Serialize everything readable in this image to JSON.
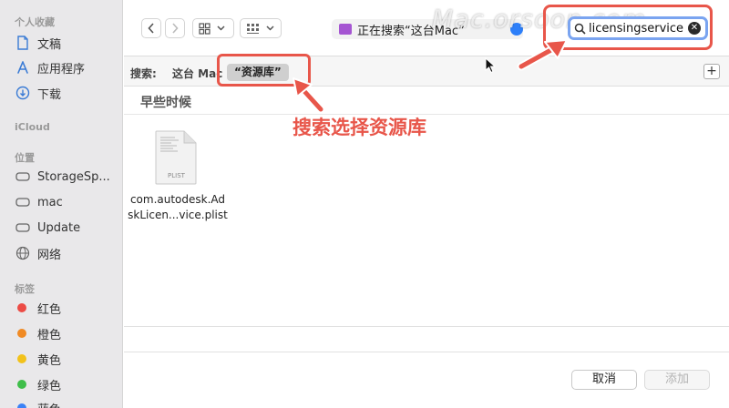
{
  "sidebar": {
    "favorites_title": "个人收藏",
    "favorites": [
      {
        "label": "文稿",
        "icon": "document-icon"
      },
      {
        "label": "应用程序",
        "icon": "applications-icon"
      },
      {
        "label": "下载",
        "icon": "download-icon"
      }
    ],
    "icloud_title": "iCloud",
    "locations_title": "位置",
    "locations": [
      {
        "label": "StorageSp...",
        "icon": "drive-icon"
      },
      {
        "label": "mac",
        "icon": "drive-icon"
      },
      {
        "label": "Update",
        "icon": "drive-icon"
      },
      {
        "label": "网络",
        "icon": "network-icon"
      }
    ],
    "tags_title": "标签",
    "tags": [
      {
        "label": "红色",
        "color": "#ec4b45"
      },
      {
        "label": "橙色",
        "color": "#f08a24"
      },
      {
        "label": "黄色",
        "color": "#f2c21b"
      },
      {
        "label": "绿色",
        "color": "#3fbe4a"
      },
      {
        "label": "蓝色",
        "color": "#3b82f6"
      }
    ]
  },
  "toolbar": {
    "path_label": "正在搜索“这台Mac”",
    "watermark": "Mac.orsoon.com",
    "search_value": "licensingservice"
  },
  "scope": {
    "label": "搜索:",
    "this_mac": "这台 Mac",
    "library": "“资源库”"
  },
  "content": {
    "group_header": "早些时候",
    "file": {
      "type_label": "PLIST",
      "name_line1": "com.autodesk.Ad",
      "name_line2": "skLicen...vice.plist"
    },
    "annotation": "搜索选择资源库"
  },
  "footer": {
    "cancel_label": "取消",
    "add_label": "添加"
  },
  "colors": {
    "accent_red": "#e8564a",
    "focus_blue": "#7aa4f0"
  }
}
